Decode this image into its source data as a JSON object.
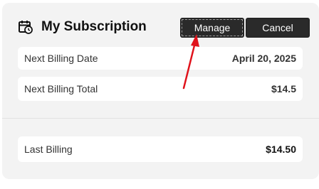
{
  "header": {
    "title": "My Subscription",
    "icon": "calendar-clock-icon"
  },
  "buttons": {
    "manage_label": "Manage",
    "cancel_label": "Cancel"
  },
  "billing": {
    "next_date_label": "Next Billing Date",
    "next_date_value": "April 20, 2025",
    "next_total_label": "Next Billing Total",
    "next_total_value": "$14.5",
    "last_label": "Last Billing",
    "last_value": "$14.50"
  },
  "colors": {
    "button_bg": "#2a2a2a",
    "card_bg": "#f3f3f3",
    "annotation_arrow": "#e0121b"
  }
}
